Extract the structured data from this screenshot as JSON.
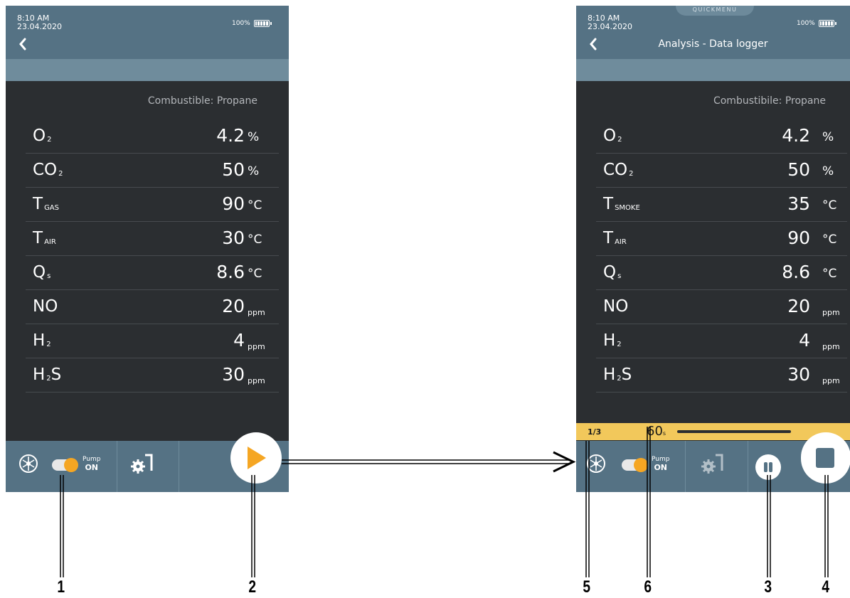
{
  "left_screen": {
    "status": {
      "time": "8:10 AM",
      "date": "23.04.2020",
      "battery": "100%"
    },
    "fuel": "Combustible: Propane",
    "readings": [
      {
        "label": "O",
        "sub": "2",
        "value": "4.2",
        "unit": "%"
      },
      {
        "label": "CO",
        "sub": "2",
        "value": "50",
        "unit": "%"
      },
      {
        "label": "T",
        "sub": "GAS",
        "value": "90",
        "unit": "°C"
      },
      {
        "label": "T",
        "sub": "AIR",
        "value": "30",
        "unit": "°C"
      },
      {
        "label": "Q",
        "sub": "s",
        "value": "8.6",
        "unit": "°C"
      },
      {
        "label": "NO",
        "sub": "",
        "value": "20",
        "unit": "ppm"
      },
      {
        "label": "H",
        "sub": "2",
        "value": "4",
        "unit": "ppm"
      },
      {
        "label": "H",
        "sub": "2",
        "label_suffix": "S",
        "value": "30",
        "unit": "ppm"
      }
    ],
    "pump": {
      "label": "Pump",
      "state": "ON"
    }
  },
  "right_screen": {
    "status": {
      "time": "8:10 AM",
      "date": "23.04.2020",
      "battery": "100%"
    },
    "quickmenu": "QUICKMENU",
    "title": "Analysis - Data logger",
    "fuel": "Combustibile: Propane",
    "readings": [
      {
        "label": "O",
        "sub": "2",
        "value": "4.2",
        "unit": "%"
      },
      {
        "label": "CO",
        "sub": "2",
        "value": "50",
        "unit": "%"
      },
      {
        "label": "T",
        "sub": "SMOKE",
        "value": "35",
        "unit": "°C"
      },
      {
        "label": "T",
        "sub": "AIR",
        "value": "90",
        "unit": "°C"
      },
      {
        "label": "Q",
        "sub": "s",
        "value": "8.6",
        "unit": "°C"
      },
      {
        "label": "NO",
        "sub": "",
        "value": "20",
        "unit": "ppm"
      },
      {
        "label": "H",
        "sub": "2",
        "value": "4",
        "unit": "ppm"
      },
      {
        "label": "H",
        "sub": "2",
        "label_suffix": "S",
        "value": "30",
        "unit": "ppm"
      }
    ],
    "logger": {
      "counter": "1/3",
      "seconds": "60",
      "seconds_unit": "s"
    },
    "pump": {
      "label": "Pump",
      "state": "ON"
    }
  },
  "callouts": [
    "1",
    "2",
    "5",
    "6",
    "3",
    "4"
  ],
  "colors": {
    "header": "#557284",
    "subbar": "#6f8c9c",
    "panel": "#2b2e31",
    "accent": "#f5a623",
    "logbar": "#f2c85b"
  }
}
